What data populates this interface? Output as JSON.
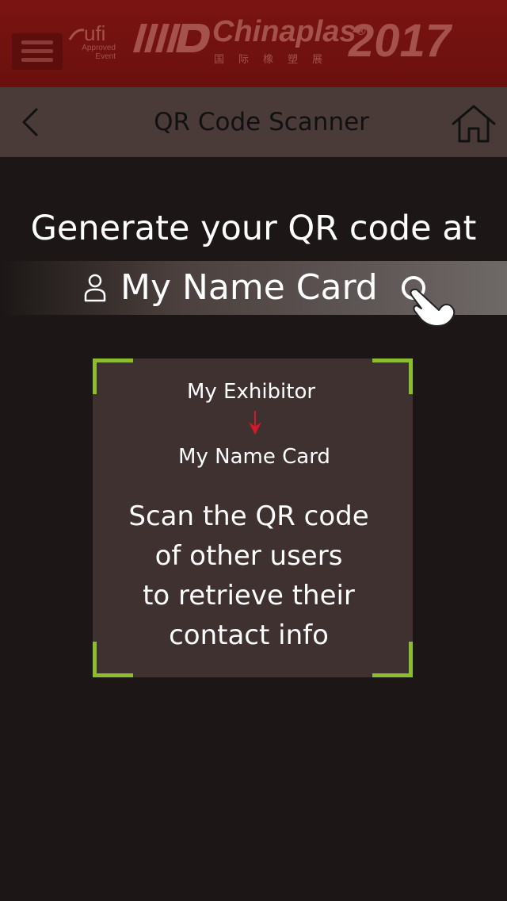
{
  "banner": {
    "ufi_word": "ufi",
    "ufi_line1": "Approved",
    "ufi_line2": "Event",
    "brand": "Chinaplas",
    "registered_mark": "®",
    "brand_chinese": "国际橡塑展",
    "year": "2017"
  },
  "navbar": {
    "title": "QR Code Scanner"
  },
  "content": {
    "headline": "Generate your QR code at",
    "card_link_label": "My Name Card",
    "step_1": "My Exhibitor",
    "step_2": "My Name Card",
    "instruction_line1": "Scan the QR code",
    "instruction_line2": "of other users",
    "instruction_line3": "to retrieve their",
    "instruction_line4": "contact info"
  },
  "icons": {
    "menu": "hamburger-menu-icon",
    "back": "chevron-left-icon",
    "home": "home-icon",
    "user": "user-icon",
    "tap": "hand-pointer-icon",
    "arrow": "arrow-down-icon"
  },
  "colors": {
    "banner_bg": "#6e110f",
    "navbar_bg": "#4a3b39",
    "page_bg": "#1c1716",
    "scan_box_bg": "#3e3130",
    "scan_corner": "#8bbd2c",
    "arrow": "#d5182a"
  }
}
